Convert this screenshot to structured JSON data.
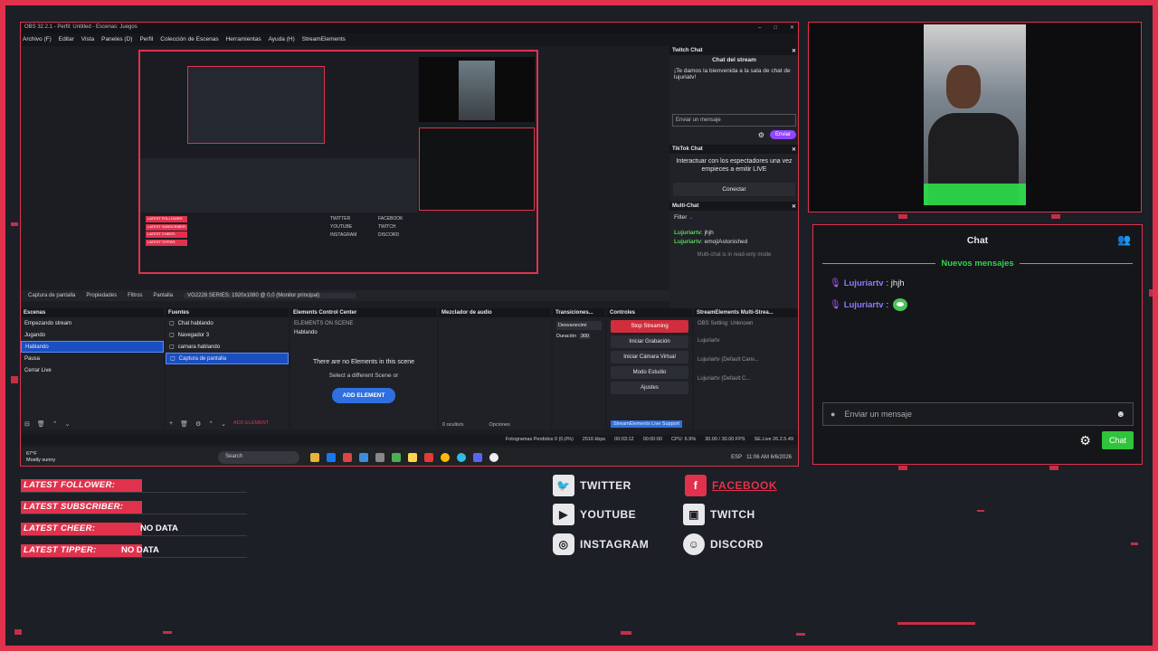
{
  "obs": {
    "title": "OBS 32.2.1 - Perfil: Untitled - Escenas: Juegos",
    "menu": [
      "Archivo (F)",
      "Editar",
      "Vista",
      "Paneles (D)",
      "Perfil",
      "Colección de Escenas",
      "Herramientas",
      "Ayuda (H)",
      "StreamElements"
    ],
    "context_bar": {
      "source": "Captura de pantalla",
      "properties": "Propiedades",
      "filters": "Filtros",
      "display_label": "Pantalla",
      "display_value": "VG2228 SERIES: 1920x1080 @ 0,0 (Monitor principal)"
    },
    "twitch_chat": {
      "panel": "Twitch Chat",
      "title": "Chat del stream",
      "welcome": "¡Te damos la bienvenida a la sala de chat de lujuriatv!",
      "input_placeholder": "Enviar un mensaje",
      "send": "Enviar"
    },
    "tiktok_chat": {
      "panel": "TikTok Chat",
      "text": "Interactuar con los espectadores una vez empieces a emitir LIVE",
      "button": "Conectar"
    },
    "multi_chat": {
      "panel": "Multi-Chat",
      "filter": "Filter",
      "messages": [
        {
          "user": "Lujuriartv",
          "text": ": jhjh"
        },
        {
          "user": "Lujuriartv",
          "text": ": emojiAstonished"
        }
      ],
      "note": "Multi-chat is in read-only mode"
    },
    "scenes": {
      "header": "Escenas",
      "items": [
        "Empezando stream",
        "Jugando",
        "Hablando",
        "Pausa",
        "Cerrar Live"
      ],
      "selected": 2
    },
    "sources": {
      "header": "Fuentes",
      "items": [
        "Chat hablando",
        "Navegador 3",
        "camara hablando",
        "Captura de pantalla"
      ],
      "selected": 3,
      "add_element": "ADD ELEMENT"
    },
    "ecc": {
      "header": "Elements Control Center",
      "subtitle": "ELEMENTS ON SCENE",
      "scene": "Hablando",
      "empty": "There are no Elements in this scene",
      "hint": "Select a different Scene or",
      "add_button": "ADD ELEMENT"
    },
    "audio_mixer": {
      "header": "Mezclador de audio",
      "hidden": "0 oculto/s",
      "options": "Opciones"
    },
    "transitions": {
      "header": "Transiciones...",
      "type": "Desvanecimi",
      "duration_label": "Duración",
      "duration_value": "300"
    },
    "controls": {
      "header": "Controles",
      "buttons": [
        "Stop Streaming",
        "Iniciar Grabación",
        "Iniciar Cámara Virtual",
        "Modo Estudio",
        "Ajustes"
      ],
      "support": "StreamElements Live Support"
    },
    "multistream": {
      "header": "StreamElements Multi-Strea...",
      "items": [
        "OBS Setting: Unknown",
        "Lujuriartv",
        "Lujuriartv (Default Canv...",
        "Lujuriartv (Default C..."
      ]
    },
    "statusbar": {
      "frames": "Fotogramas Perdidos 0 (0,0%)",
      "kbps": "2516 kbps",
      "time": "00:03:12",
      "rec": "00:00:00",
      "cpu": "CPU: 6.9%",
      "fps": "30.00 / 30.00 FPS",
      "se": "SE.Live 26.2.5.49"
    },
    "taskbar": {
      "weather": "67°F",
      "weather_desc": "Mostly sunny",
      "search": "Search",
      "lang": "ESP",
      "clock": "11:06 AM",
      "date": "6/6/2026"
    }
  },
  "chat": {
    "title": "Chat",
    "new_messages": "Nuevos mensajes",
    "messages": [
      {
        "user": "Lujuriartv",
        "text": ": jhjh"
      },
      {
        "user": "Lujuriartv",
        "text": ": "
      }
    ],
    "input_placeholder": "Enviar un mensaje",
    "send": "Chat"
  },
  "latest": [
    {
      "label": "LATEST FOLLOWER:",
      "value": ""
    },
    {
      "label": "LATEST SUBSCRIBER:",
      "value": ""
    },
    {
      "label": "LATEST CHEER:",
      "value": "NO DATA"
    },
    {
      "label": "LATEST TIPPER:",
      "value": "NO DATA"
    }
  ],
  "social": {
    "twitter": "TWITTER",
    "facebook": "FACEBOOK",
    "youtube": "YOUTUBE",
    "twitch": "TWITCH",
    "instagram": "INSTAGRAM",
    "discord": "DISCORD"
  },
  "colors": {
    "accent": "#e0324d",
    "chat_green": "#2fc43b",
    "twitch_purple": "#9146ff",
    "selection_blue": "#1a4fc4"
  }
}
